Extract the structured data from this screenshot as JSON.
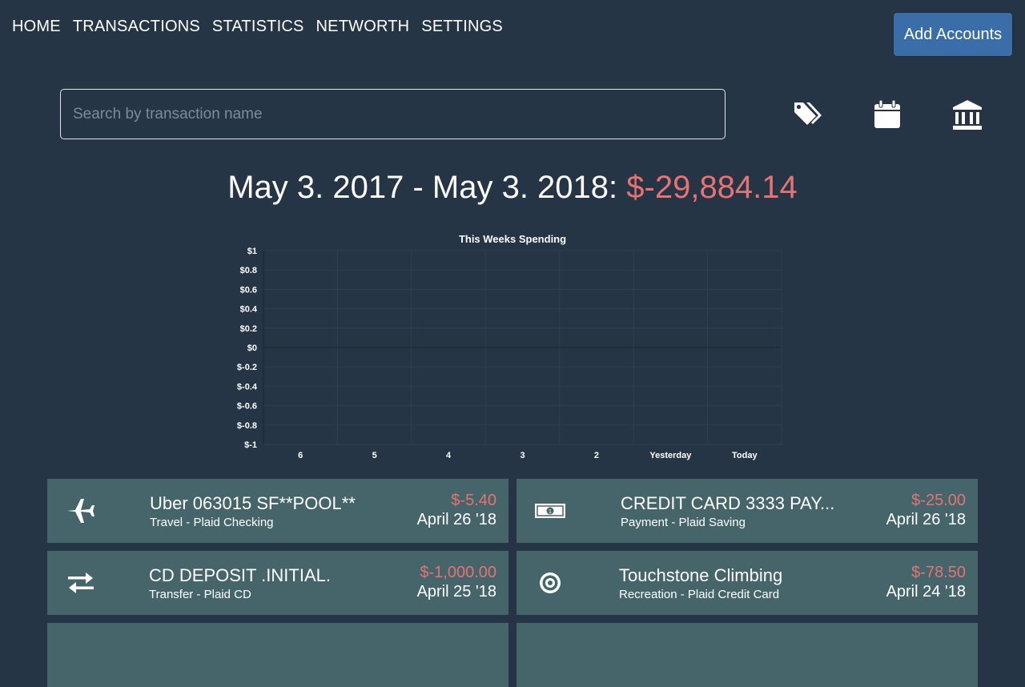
{
  "nav": {
    "items": [
      "HOME",
      "TRANSACTIONS",
      "STATISTICS",
      "NETWORTH",
      "SETTINGS"
    ],
    "add_accounts": "Add Accounts"
  },
  "search": {
    "placeholder": "Search by transaction name",
    "value": ""
  },
  "toolbar": {
    "icons": [
      "tags-icon",
      "calendar-icon",
      "bank-icon"
    ]
  },
  "summary": {
    "range": "May 3. 2017 - May 3. 2018: ",
    "total": "$-29,884.14"
  },
  "colors": {
    "background": "#263546",
    "card": "#46656a",
    "negative": "#e57373",
    "button": "#3b6ea8"
  },
  "chart_data": {
    "type": "line",
    "title": "This Weeks Spending",
    "categories": [
      "6",
      "5",
      "4",
      "3",
      "2",
      "Yesterday",
      "Today"
    ],
    "series": [
      {
        "values": [
          0,
          0,
          0,
          0,
          0,
          0,
          0
        ]
      }
    ],
    "y_ticks": [
      "$1",
      "$0.8",
      "$0.6",
      "$0.4",
      "$0.2",
      "$0",
      "$-0.2",
      "$-0.4",
      "$-0.6",
      "$-0.8",
      "$-1"
    ],
    "ylim": [
      -1,
      1
    ],
    "xlabel": "",
    "ylabel": "",
    "grid": true
  },
  "transactions": [
    {
      "icon": "airplane-icon",
      "name": "Uber 063015 SF**POOL**",
      "sub": "Travel - Plaid Checking",
      "amount": "$-5.40",
      "date": "April 26 '18"
    },
    {
      "icon": "money-icon",
      "name": "CREDIT CARD 3333 PAY...",
      "sub": "Payment - Plaid Saving",
      "amount": "$-25.00",
      "date": "April 26 '18"
    },
    {
      "icon": "transfer-icon",
      "name": "CD DEPOSIT .INITIAL.",
      "sub": "Transfer - Plaid CD",
      "amount": "$-1,000.00",
      "date": "April 25 '18"
    },
    {
      "icon": "target-icon",
      "name": "Touchstone Climbing",
      "sub": "Recreation - Plaid Credit Card",
      "amount": "$-78.50",
      "date": "April 24 '18"
    }
  ]
}
